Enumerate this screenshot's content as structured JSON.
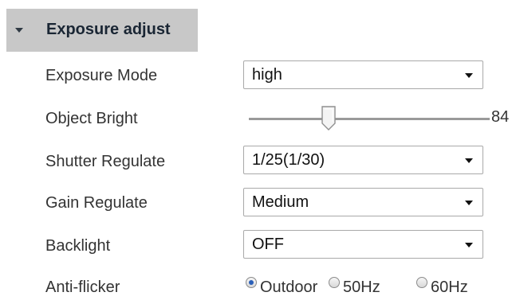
{
  "section": {
    "title": "Exposure adjust"
  },
  "fields": {
    "exposure_mode": {
      "label": "Exposure Mode",
      "value": "high"
    },
    "object_bright": {
      "label": "Object Bright",
      "value": "84",
      "level_fraction": 0.33
    },
    "shutter_regulate": {
      "label": "Shutter Regulate",
      "value": "1/25(1/30)"
    },
    "gain_regulate": {
      "label": "Gain Regulate",
      "value": "Medium"
    },
    "backlight": {
      "label": "Backlight",
      "value": "OFF"
    },
    "anti_flicker": {
      "label": "Anti-flicker",
      "options": [
        {
          "label": "Outdoor",
          "checked": true
        },
        {
          "label": "50Hz",
          "checked": false
        },
        {
          "label": "60Hz",
          "checked": false
        }
      ]
    }
  },
  "colors": {
    "header_bg": "#c8c8c8",
    "radio_checked": "#2a5fb8"
  }
}
